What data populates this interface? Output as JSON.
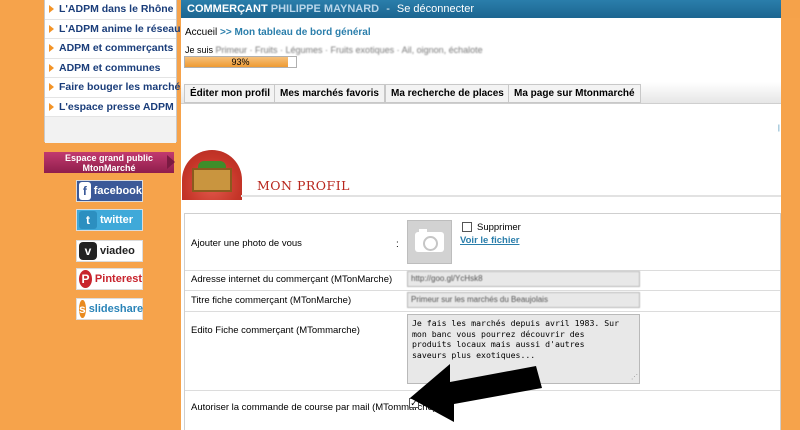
{
  "sidebar": {
    "items": [
      {
        "label": "L'ADPM dans le Rhône"
      },
      {
        "label": "L'ADPM anime le réseau"
      },
      {
        "label": "ADPM et commerçants"
      },
      {
        "label": "ADPM et communes"
      },
      {
        "label": "Faire bouger les marchés"
      },
      {
        "label": "L'espace presse ADPM"
      }
    ],
    "espace_line1": "Espace grand public",
    "espace_line2": "MtonMarché",
    "social": {
      "facebook": "facebook",
      "twitter": "twitter",
      "viadeo": "viadeo",
      "pinterest": "Pinterest",
      "slideshare": "slideshare"
    }
  },
  "header": {
    "brand": "COMMERÇANT",
    "user_name": "PHILIPPE MAYNARD",
    "separator": "-",
    "logout": "Se déconnecter"
  },
  "breadcrumb": {
    "home": "Accueil",
    "arrow": ">>",
    "current": "Mon tableau de bord général"
  },
  "profile_summary": {
    "je_suis_label": "Je suis",
    "je_suis_value": "Primeur · Fruits · Légumes · Fruits exotiques · Ail, oignon, échalote",
    "progress_percent": 93,
    "progress_label": "93%"
  },
  "tabs": [
    {
      "label": "Éditer mon profil"
    },
    {
      "label": "Mes marchés favoris"
    },
    {
      "label": "Ma recherche de places"
    },
    {
      "label": "Ma page sur Mtonmarché"
    }
  ],
  "section": {
    "title": "MON PROFIL"
  },
  "form": {
    "photo_label": "Ajouter une photo de vous",
    "photo_colon": ":",
    "delete_label": "Supprimer",
    "view_file_link": "Voir le fichier",
    "url_label": "Adresse internet du commerçant (MTonMarche)",
    "url_value": "http://goo.gl/YcHsk8",
    "title_label": "Titre fiche commerçant (MTonMarche)",
    "title_value": "Primeur sur les marchés du Beaujolais",
    "edito_label": "Edito Fiche commerçant (MTommarche)",
    "edito_value": "Je fais les marchés depuis avril 1983. Sur\nmon banc vous pourrez découvrir des\nproduits locaux mais aussi d'autres\nsaveurs plus exotiques...",
    "mail_label": "Autoriser la commande de course par mail (MTommarche)",
    "mail_checked_mark": "✓"
  },
  "colors": {
    "orange_bg": "#f5a24a",
    "topbar_blue": "#1c6590",
    "link_blue": "#2a7eab",
    "profile_red": "#b8261d",
    "nav_text": "#1a3d7a"
  }
}
